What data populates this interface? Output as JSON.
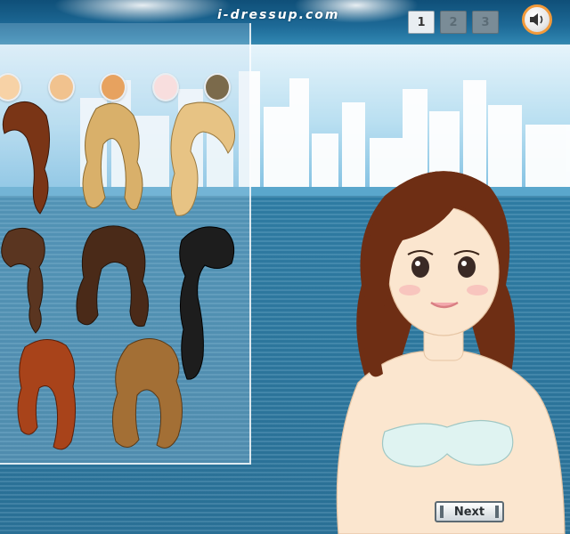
{
  "header": {
    "brand": "i-dressup.com",
    "pages": [
      "1",
      "2",
      "3"
    ],
    "current_page": "1",
    "sound_icon": "speaker-icon"
  },
  "palette": {
    "colors": [
      "#f7d2a6",
      "#f1c28e",
      "#e7a25f",
      "#f8dede",
      "#7b6a4b"
    ]
  },
  "hairstyles": [
    {
      "id": "auburn-long-wavy",
      "color": "#7a3516"
    },
    {
      "id": "blonde-curly",
      "color": "#d9b06a"
    },
    {
      "id": "blonde-side-ponytail",
      "color": "#e7c384"
    },
    {
      "id": "brown-braids",
      "color": "#5a3520"
    },
    {
      "id": "dark-brown-long",
      "color": "#4a2a18"
    },
    {
      "id": "black-side-long",
      "color": "#1d1d1d"
    },
    {
      "id": "red-straight",
      "color": "#a8431a"
    },
    {
      "id": "light-brown-pigtails",
      "color": "#a36f35"
    }
  ],
  "doll": {
    "hair_color": "#6e2e14",
    "skin_color": "#fbe6cf",
    "top_color": "#dff3f1"
  },
  "controls": {
    "next_label": "Next"
  }
}
